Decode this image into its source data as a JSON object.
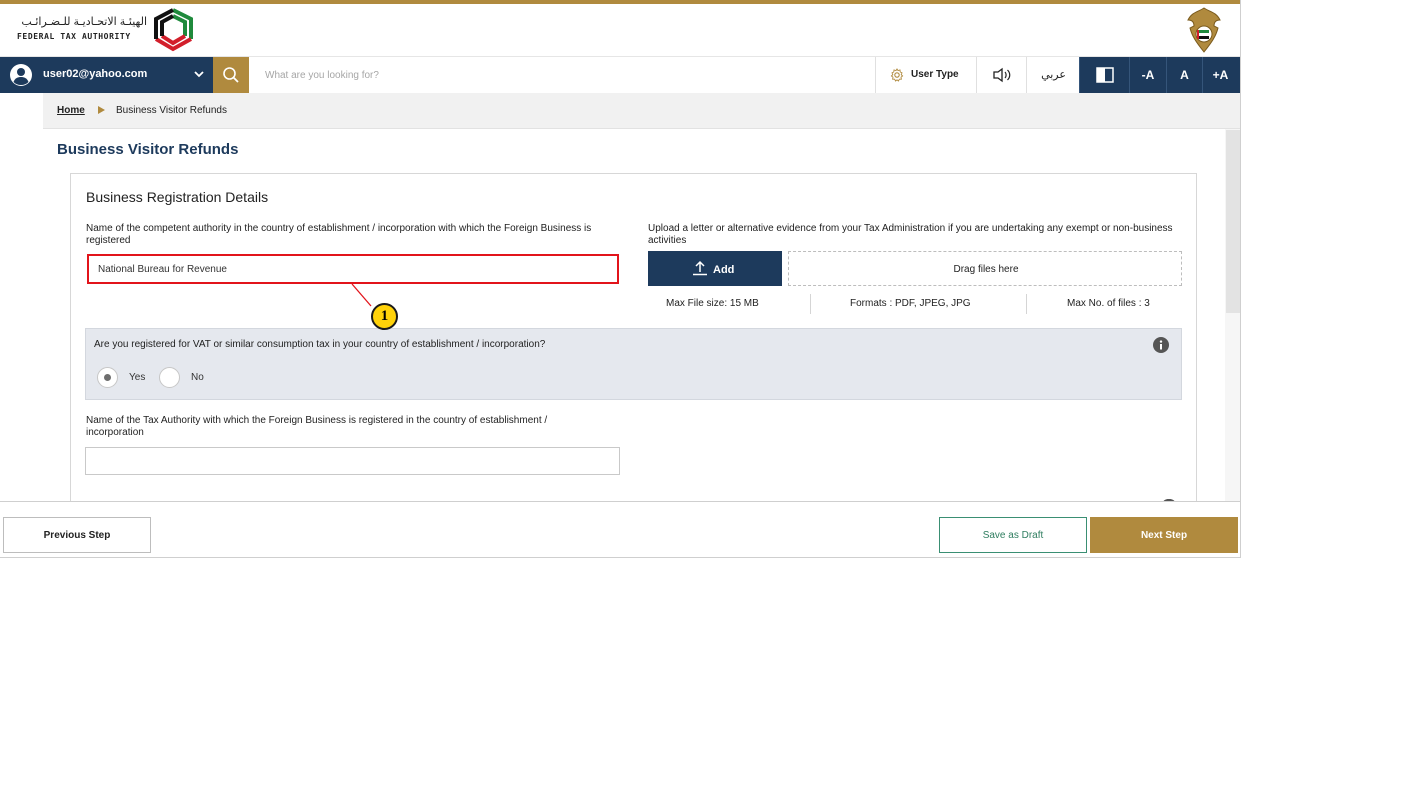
{
  "header": {
    "logo_arabic": "الهيئـة الاتحـاديـة للـضـرائـب",
    "logo_english": "FEDERAL TAX AUTHORITY",
    "emblem_icon": "uae-emblem-icon",
    "accent_color": "#b08a3e",
    "navy_color": "#1d3a5c"
  },
  "navbar": {
    "user_email": "user02@yahoo.com",
    "search_placeholder": "What are you looking for?",
    "user_type_label": "User Type",
    "language_label": "عربي",
    "font_decrease": "-A",
    "font_normal": "A",
    "font_increase": "+A"
  },
  "breadcrumb": {
    "home": "Home",
    "current": "Business Visitor Refunds"
  },
  "page_title": "Business Visitor Refunds",
  "form": {
    "section_title": "Business Registration Details",
    "authority_label": "Name of the competent authority in the country of establishment / incorporation with which the Foreign Business is registered",
    "authority_value": "National Bureau for Revenue",
    "upload_label": "Upload a letter or alternative evidence from your Tax Administration if you are undertaking any exempt or non-business activities",
    "add_button": "Add",
    "drop_text": "Drag files here",
    "max_size": "Max File size: 15 MB",
    "formats": "Formats : PDF, JPEG, JPG",
    "max_files": "Max No. of files : 3",
    "vat_question": "Are you registered for VAT or similar consumption tax in your country of establishment / incorporation?",
    "vat_yes": "Yes",
    "vat_no": "No",
    "vat_selected": "Yes",
    "tax_authority_label": "Name of the Tax Authority with which the Foreign Business is registered in the country of establishment / incorporation",
    "tax_authority_value": ""
  },
  "annotation": {
    "badge": "1",
    "highlight_color": "#e2141b"
  },
  "footer": {
    "previous": "Previous Step",
    "save_draft": "Save as Draft",
    "next": "Next Step"
  }
}
